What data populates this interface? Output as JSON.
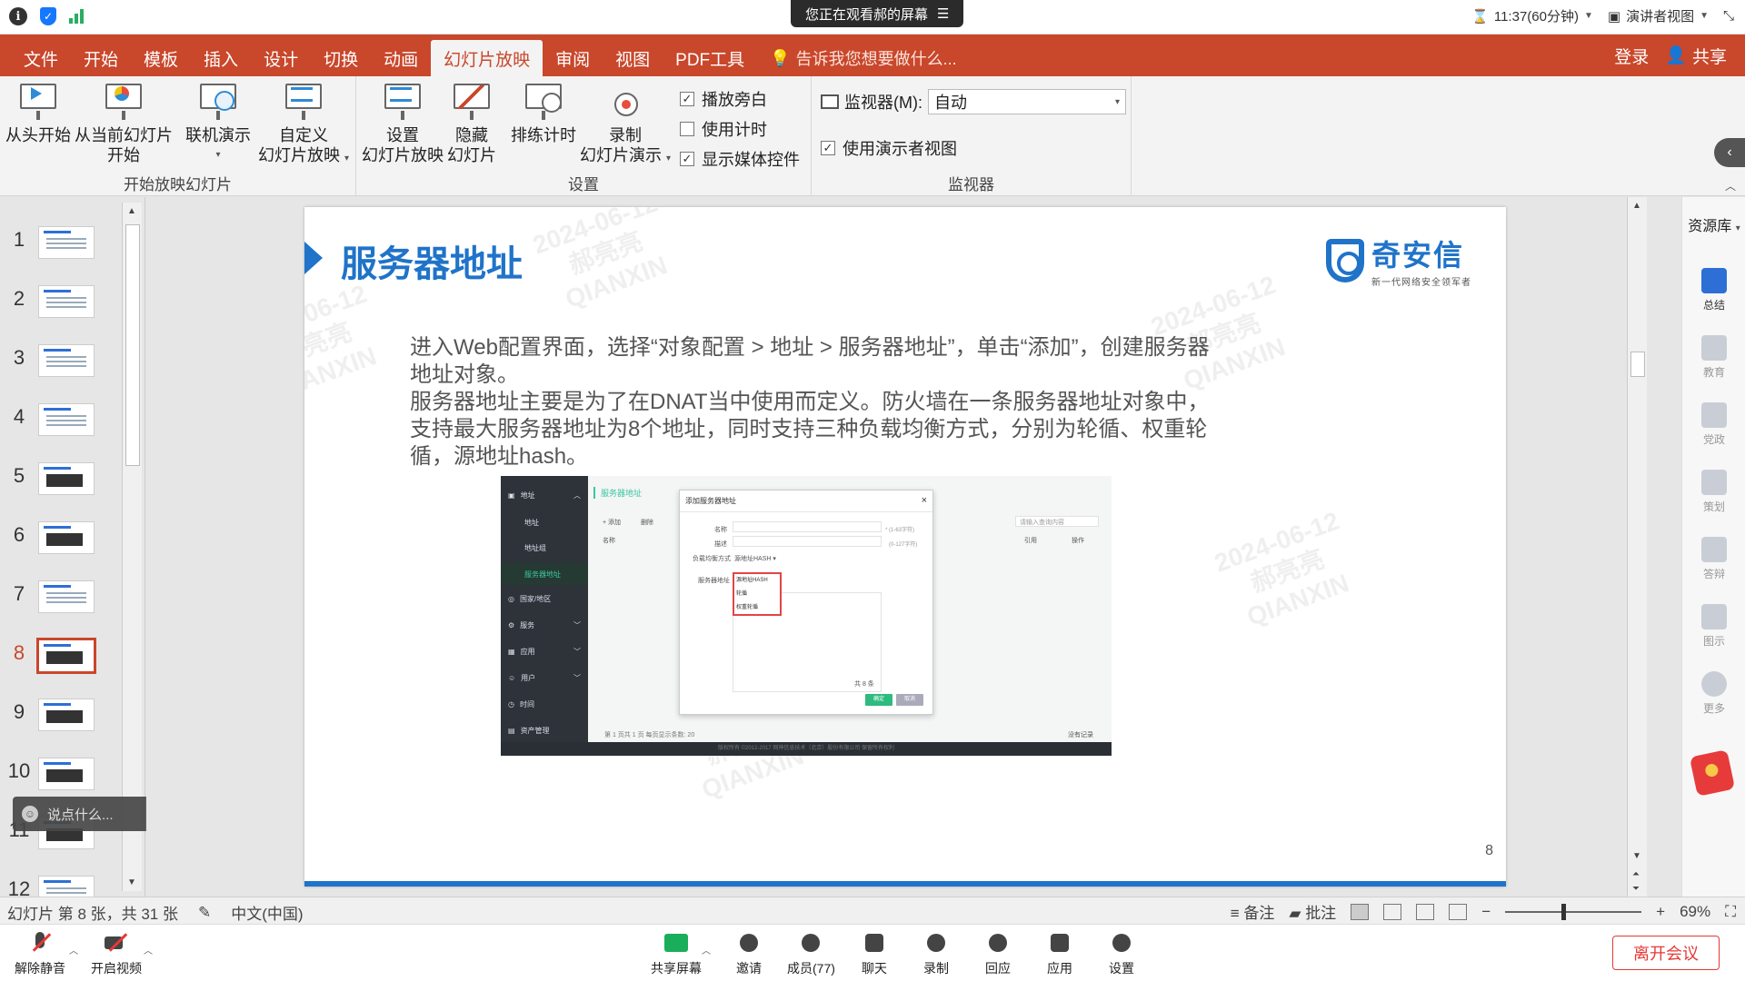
{
  "meeting": {
    "banner": "您正在观看郝的屏幕",
    "time": "11:37(60分钟)",
    "presenter_view": "演讲者视图"
  },
  "ribbon_tabs": [
    "文件",
    "开始",
    "模板",
    "插入",
    "设计",
    "切换",
    "动画",
    "幻灯片放映",
    "审阅",
    "视图",
    "PDF工具"
  ],
  "tell_me": "告诉我您想要做什么...",
  "login": "登录",
  "share": "共享",
  "groups": {
    "start_show": {
      "label": "开始放映幻灯片",
      "from_beginning": "从头开始",
      "from_current_1": "从当前幻灯片",
      "from_current_2": "开始",
      "online_1": "联机演示",
      "custom_1": "自定义",
      "custom_2": "幻灯片放映"
    },
    "setup": {
      "label": "设置",
      "setup_1": "设置",
      "setup_2": "幻灯片放映",
      "hide_1": "隐藏",
      "hide_2": "幻灯片",
      "rehearse": "排练计时",
      "record_1": "录制",
      "record_2": "幻灯片演示",
      "play_narration": "播放旁白",
      "use_timing": "使用计时",
      "show_media": "显示媒体控件"
    },
    "monitor": {
      "label": "监视器",
      "monitor_label": "监视器(M):",
      "monitor_value": "自动",
      "presenter_view": "使用演示者视图"
    }
  },
  "thumbnails": [
    "1",
    "2",
    "3",
    "4",
    "5",
    "6",
    "7",
    "8",
    "9",
    "10",
    "11",
    "12"
  ],
  "active_slide": 8,
  "say_placeholder": "说点什么...",
  "slide": {
    "title": "服务器地址",
    "logo_name": "奇安信",
    "logo_sub": "新一代网络安全领军者",
    "body_1": "进入Web配置界面，选择“对象配置 > 地址 > 服务器地址”，单击“添加”，创建服务器地址对象。",
    "body_2": "服务器地址主要是为了在DNAT当中使用而定义。防火墙在一条服务器地址对象中，支持最大服务器地址为8个地址，同时支持三种负载均衡方式，分别为轮循、权重轮循，源地址hash。",
    "page_number": "8",
    "watermark_date": "2024-06-12",
    "watermark_name": "郝亮亮",
    "watermark_org": "QIANXIN"
  },
  "shot": {
    "side_items": [
      {
        "label": "地址"
      },
      {
        "label": "地址"
      },
      {
        "label": "地址组"
      },
      {
        "label": "服务器地址"
      },
      {
        "label": "国家/地区"
      },
      {
        "label": "服务"
      },
      {
        "label": "应用"
      },
      {
        "label": "用户"
      },
      {
        "label": "时间"
      },
      {
        "label": "资产管理"
      }
    ],
    "tab": "服务器地址",
    "add": "+ 添加",
    "delete": "删除",
    "search_placeholder": "请输入查询内容",
    "col_name": "名称",
    "col_ref": "引用",
    "col_op": "操作",
    "dialog_title": "添加服务器地址",
    "field_name": "名称",
    "field_desc": "描述",
    "field_lb": "负载均衡方式",
    "field_servers": "服务器地址",
    "hint_name": "* (1-63字符)",
    "hint_desc": "(0-127字符)",
    "lb_value": "源地址HASH",
    "lb_options": [
      "源地址HASH",
      "轮循",
      "权重轮循"
    ],
    "count": "共 8 条",
    "ok": "确定",
    "cancel": "取消",
    "page_info_1": "第 1",
    "page_info_2": "页共 1 页",
    "per_page": "每页显示条数: 20",
    "no_records": "没有记录",
    "footer": "版权所有 ©2012-2017 网神信息技术（北京）股份有限公司 保留所有权利"
  },
  "sidepanel": {
    "head": "资源库",
    "items": [
      "总结",
      "教育",
      "党政",
      "策划",
      "答辩",
      "图示",
      "更多"
    ]
  },
  "status": {
    "slide_info": "幻灯片 第 8 张，共 31 张",
    "language": "中文(中国)",
    "notes": "备注",
    "comments": "批注",
    "zoom": "69%"
  },
  "meet_tools": {
    "unmute": "解除静音",
    "video": "开启视频",
    "share_screen": "共享屏幕",
    "invite": "邀请",
    "members": "成员(77)",
    "chat": "聊天",
    "record": "录制",
    "react": "回应",
    "apps": "应用",
    "settings": "设置",
    "leave": "离开会议"
  }
}
